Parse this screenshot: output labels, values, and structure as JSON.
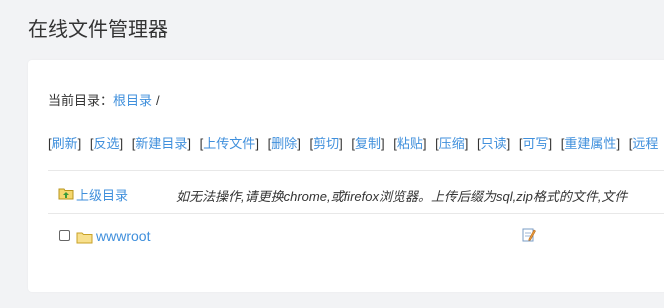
{
  "page": {
    "title": "在线文件管理器"
  },
  "breadcrumb": {
    "label": "当前目录：",
    "root": "根目录",
    "separator": "/"
  },
  "toolbar": {
    "items": [
      "刷新",
      "反选",
      "新建目录",
      "上传文件",
      "删除",
      "剪切",
      "复制",
      "粘贴",
      "压缩",
      "只读",
      "可写",
      "重建属性",
      "远程"
    ]
  },
  "file_list": {
    "up_label": "上级目录",
    "notice": "如无法操作,请更换chrome,或firefox浏览器。上传后缀为sql,zip格式的文件,文件",
    "rows": [
      {
        "name": "wwwroot"
      }
    ]
  },
  "colors": {
    "link": "#3f8fdc",
    "background": "#f2f3f5",
    "card": "#ffffff",
    "text": "#333333"
  },
  "icons": {
    "up": "folder-up-icon",
    "folder": "folder-icon",
    "edit": "edit-icon"
  }
}
